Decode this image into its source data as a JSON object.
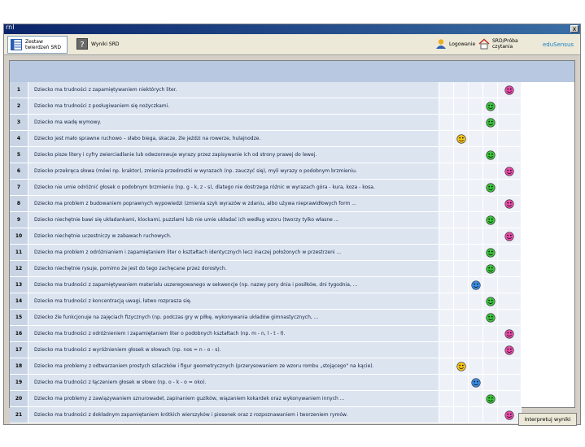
{
  "window": {
    "title": "rnl",
    "close_label": "x"
  },
  "toolbar": {
    "tab1_label_line1": "Zestaw",
    "tab1_label_line2": "twierdzeń SRD",
    "tab2_label": "Wyniki SRD",
    "login_label": "Logowanie",
    "home_label_line1": "SRD/Próba",
    "home_label_line2": "czytania",
    "logo_text": "eduSensus"
  },
  "colors": {
    "green": "#3cc43c",
    "pink": "#e84aa8",
    "yellow": "#f5c518",
    "blue": "#3a8fe8"
  },
  "rows": [
    {
      "num": "1",
      "text": "Dziecko ma trudności z zapamiętywaniem niektórych liter.",
      "face": "pink",
      "col": 4
    },
    {
      "num": "2",
      "text": "Dziecko ma trudności z posługiwaniem się nożyczkami.",
      "face": "green",
      "col": 3
    },
    {
      "num": "3",
      "text": "Dziecko ma wadę wymowy.",
      "face": "green",
      "col": 3
    },
    {
      "num": "4",
      "text": "Dziecko jest mało sprawne ruchowo – słabo biega, skacze, źle jeździ na rowerze, hulajnodze.",
      "face": "yellow",
      "col": 1
    },
    {
      "num": "5",
      "text": "Dziecko pisze litery i cyfry zwierciadlanie lub odwzorowuje wyrazy przez zapisywanie ich od strony prawej do lewej.",
      "face": "green",
      "col": 3
    },
    {
      "num": "6",
      "text": "Dziecko przekręca słowa (mówi np. kraktor), zmienia przedrostki w wyrazach (np. zauczyć się), myli wyrazy o podobnym brzmieniu.",
      "face": "pink",
      "col": 4
    },
    {
      "num": "7",
      "text": "Dziecko nie umie odróżnić głosek o podobnym brzmieniu (np. g - k, z - s), dlatego nie dostrzega różnic w wyrazach góra - kura, koza - kosa.",
      "face": "green",
      "col": 3
    },
    {
      "num": "8",
      "text": "Dziecko ma problem z budowaniem poprawnych wypowiedzi (zmienia szyk wyrazów w zdaniu, albo używa nieprawidłowych form ...",
      "face": "pink",
      "col": 4
    },
    {
      "num": "9",
      "text": "Dziecko niechętnie bawi się układankami, klockami, puzzlami lub nie umie układać ich według wzoru (tworzy tylko własne ...",
      "face": "green",
      "col": 3
    },
    {
      "num": "10",
      "text": "Dziecko niechętnie uczestniczy w zabawach ruchowych.",
      "face": "pink",
      "col": 4
    },
    {
      "num": "11",
      "text": "Dziecko ma problem z odróżnianiem i zapamiętaniem liter o kształtach identycznych lecz  inaczej położonych w przestrzeni ...",
      "face": "green",
      "col": 3
    },
    {
      "num": "12",
      "text": "Dziecko niechętnie rysuje, pomimo że jest do tego zachęcane przez dorosłych.",
      "face": "green",
      "col": 3
    },
    {
      "num": "13",
      "text": "Dziecko ma trudności z zapamiętywaniem materiału uszeregowanego w sekwencje (np. nazwy pory dnia i posiłków, dni tygodnia, ...",
      "face": "blue",
      "col": 2
    },
    {
      "num": "14",
      "text": "Dziecko ma trudności z koncentracją uwagi, łatwo rozprasza się.",
      "face": "green",
      "col": 3
    },
    {
      "num": "15",
      "text": "Dziecko źle funkcjonuje na zajęciach fizycznych (np. podczas gry w piłkę, wykonywania układów gimnastycznych, ...",
      "face": "green",
      "col": 3
    },
    {
      "num": "16",
      "text": "Dziecko ma trudności z odróżnieniem i zapamiętaniem liter o podobnych kształtach (np. m - n, l - t - ł).",
      "face": "pink",
      "col": 4
    },
    {
      "num": "17",
      "text": "Dziecko ma trudności z wyróżnieniem głosek w słowach (np. nos = n - o - s).",
      "face": "pink",
      "col": 4
    },
    {
      "num": "18",
      "text": "Dziecko ma problemy z odtwarzaniem prostych szlaczków i figur geometrycznych (przerysowaniem ze wzoru rombu „stojącego\" na kącie).",
      "face": "yellow",
      "col": 1
    },
    {
      "num": "19",
      "text": "Dziecko ma trudności z łączeniem głosek w słowo (np. o - k - o = oko).",
      "face": "blue",
      "col": 2
    },
    {
      "num": "20",
      "text": "Dziecko ma problemy z zawiązywaniem sznurowadeł, zapinaniem guzików, wiązaniem kokardek oraz wykonywaniem innych ...",
      "face": "green",
      "col": 3
    },
    {
      "num": "21",
      "text": "Dziecko ma trudności z dokładnym zapamiętaniem krótkich wierszyków i piosenek oraz z rozpoznawaniem i tworzeniem rymów.",
      "face": "pink",
      "col": 4
    }
  ],
  "footer": {
    "interpret_label": "Interpretuj wyniki"
  }
}
